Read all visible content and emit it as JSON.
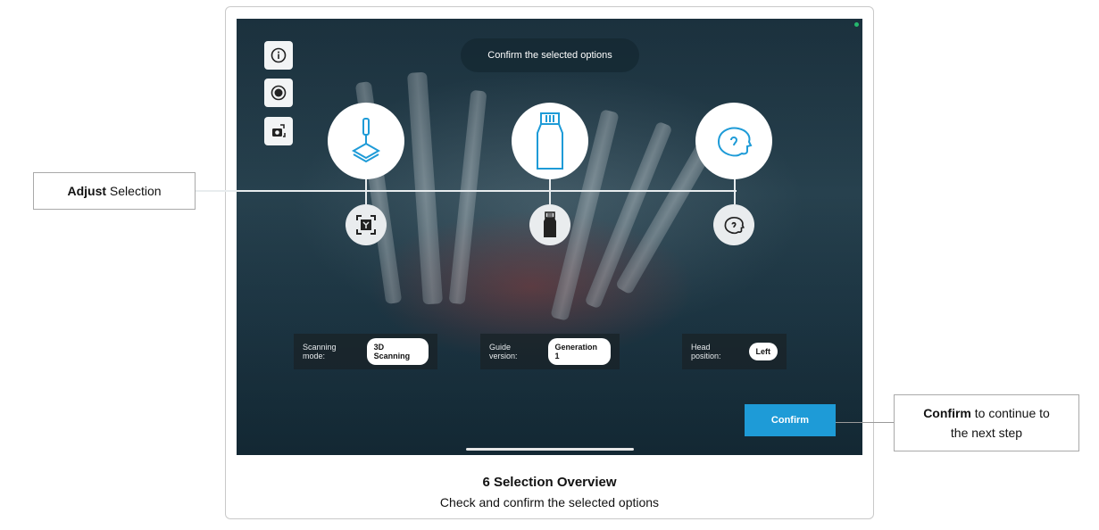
{
  "screen": {
    "header_pill": "Confirm the selected options",
    "tools": [
      {
        "icon": "info-icon"
      },
      {
        "icon": "record-icon"
      },
      {
        "icon": "camera-switch-icon"
      }
    ],
    "options": [
      {
        "big_icon": "3d-scanning-icon",
        "small_icon": "scan-target-icon"
      },
      {
        "big_icon": "guide-generation-icon",
        "small_icon": "guide-small-icon"
      },
      {
        "big_icon": "head-left-icon",
        "small_icon": "head-small-icon"
      }
    ],
    "chips": [
      {
        "label": "Scanning mode:",
        "value": "3D Scanning"
      },
      {
        "label": "Guide version:",
        "value": "Generation 1"
      },
      {
        "label": "Head position:",
        "value": "Left"
      }
    ],
    "confirm_label": "Confirm",
    "accent": "#1e9bd7"
  },
  "callouts": {
    "adjust_bold": "Adjust",
    "adjust_rest": " Selection",
    "confirm_bold": "Confirm",
    "confirm_rest1": " to continue to",
    "confirm_rest2": "the next step"
  },
  "caption": {
    "title": "6 Selection Overview",
    "subtitle": "Check and confirm the selected options"
  }
}
